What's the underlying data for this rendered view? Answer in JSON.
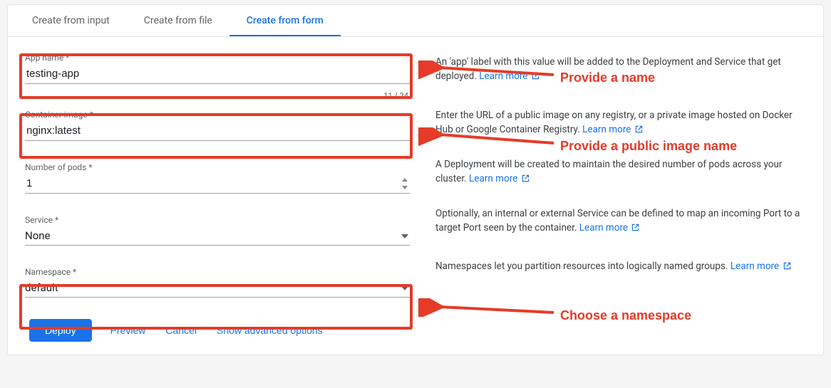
{
  "tabs": {
    "input": {
      "label": "Create from input"
    },
    "file": {
      "label": "Create from file"
    },
    "form": {
      "label": "Create from form"
    }
  },
  "fields": {
    "appName": {
      "label": "App name *",
      "value": "testing-app",
      "counter": "11 / 24"
    },
    "image": {
      "label": "Container image *",
      "value": "nginx:latest"
    },
    "pods": {
      "label": "Number of pods *",
      "value": "1"
    },
    "service": {
      "label": "Service *",
      "value": "None"
    },
    "namespace": {
      "label": "Namespace *",
      "value": "default"
    }
  },
  "help": {
    "appName": "An 'app' label with this value will be added to the Deployment and Service that get deployed.",
    "image": "Enter the URL of a public image on any registry, or a private image hosted on Docker Hub or Google Container Registry.",
    "pods": "A Deployment will be created to maintain the desired number of pods across your cluster.",
    "service": "Optionally, an internal or external Service can be defined to map an incoming Port to a target Port seen by the container.",
    "namespace": "Namespaces let you partition resources into logically named groups.",
    "learnMore": "Learn more"
  },
  "buttons": {
    "deploy": "Deploy",
    "preview": "Preview",
    "cancel": "Cancel",
    "advanced": "Show advanced options"
  },
  "annotations": {
    "name": "Provide a name",
    "image": "Provide a public image name",
    "namespace": "Choose a namespace"
  }
}
